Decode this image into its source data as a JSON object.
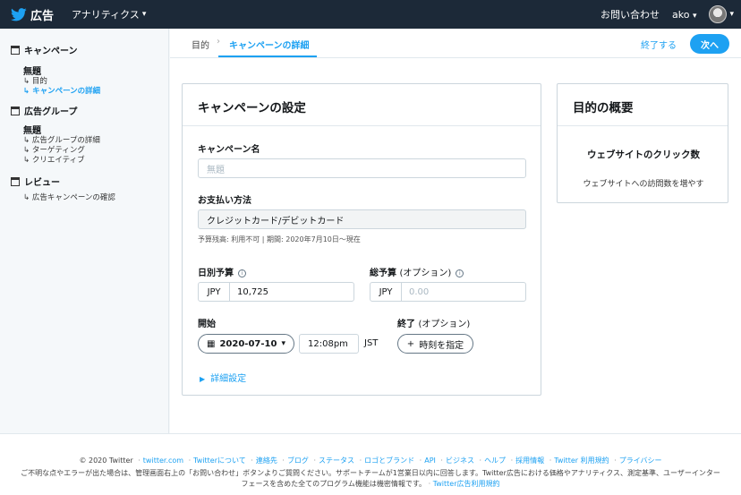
{
  "topbar": {
    "brand": "広告",
    "menu": "アナリティクス",
    "contact": "お問い合わせ",
    "user": "ako"
  },
  "sidebar": {
    "campaign": {
      "label": "キャンペーン",
      "title": "無題",
      "items": [
        "目的",
        "キャンペーンの詳細"
      ]
    },
    "adgroup": {
      "label": "広告グループ",
      "title": "無題",
      "items": [
        "広告グループの詳細",
        "ターゲティング",
        "クリエイティブ"
      ]
    },
    "review": {
      "label": "レビュー",
      "items": [
        "広告キャンペーンの確認"
      ]
    }
  },
  "subnav": {
    "step1": "目的",
    "step2": "キャンペーンの詳細",
    "finish": "終了する",
    "next": "次へ"
  },
  "settings": {
    "title": "キャンペーンの設定",
    "name_label": "キャンペーン名",
    "name_placeholder": "無題",
    "payment_label": "お支払い方法",
    "payment_value": "クレジットカード/デビットカード",
    "payment_note": "予算残高: 利用不可 | 期間: 2020年7月10日〜現在",
    "daily_label": "日別予算",
    "daily_currency": "JPY",
    "daily_value": "10,725",
    "total_label": "総予算",
    "total_optional": "(オプション)",
    "total_currency": "JPY",
    "total_placeholder": "0.00",
    "start_label": "開始",
    "start_date": "2020-07-10",
    "start_time": "12:08pm",
    "timezone": "JST",
    "end_label": "終了",
    "end_optional": "(オプション)",
    "end_button": "時刻を指定",
    "details_link": "詳細設定"
  },
  "summary": {
    "title": "目的の概要",
    "objective": "ウェブサイトのクリック数",
    "description": "ウェブサイトへの訪問数を増やす"
  },
  "footer": {
    "copyright": "© 2020 Twitter",
    "links": [
      "twitter.com",
      "Twitterについて",
      "連絡先",
      "ブログ",
      "ステータス",
      "ロゴとブランド",
      "API",
      "ビジネス",
      "ヘルプ",
      "採用情報",
      "Twitter 利用規約",
      "プライバシー"
    ],
    "note": "ご不明な点やエラーが出た場合は、管理画面右上の「お問い合わせ」ボタンよりご質問ください。サポートチームが1営業日以内に回答します。Twitter広告における価格やアナリティクス、測定基準、ユーザーインターフェースを含めた全てのプログラム機能は機密情報です。",
    "note_link": "Twitter広告利用規約"
  }
}
